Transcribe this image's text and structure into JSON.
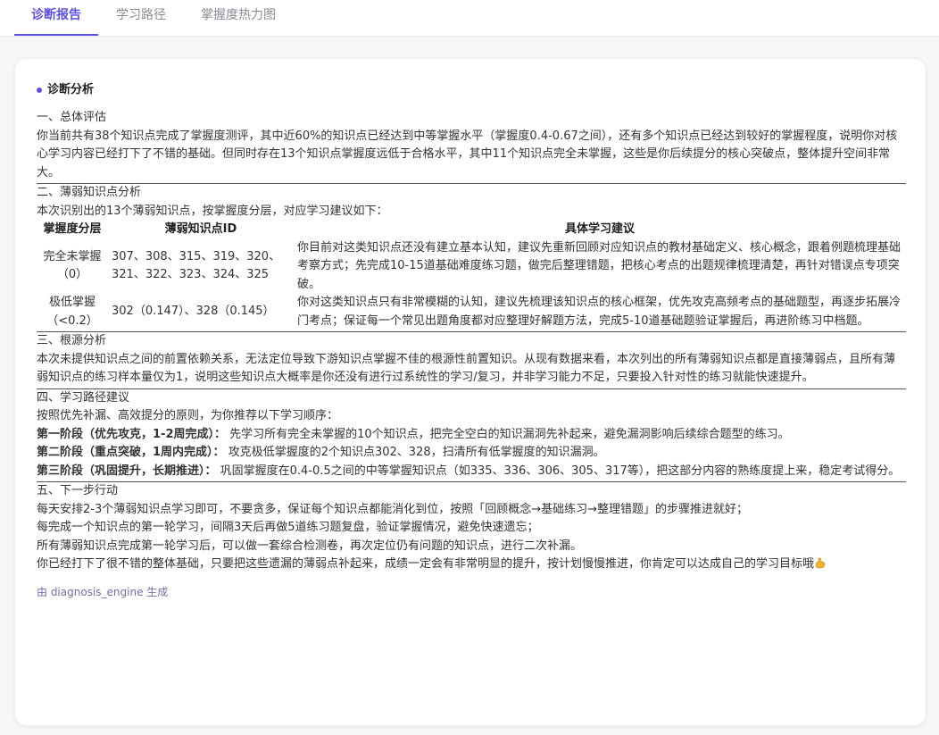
{
  "tabs": [
    {
      "label": "诊断报告",
      "active": true
    },
    {
      "label": "学习路径",
      "active": false
    },
    {
      "label": "掌握度热力图",
      "active": false
    }
  ],
  "colors": {
    "accent": "#5b4fe8",
    "footer_text": "#6f6fae"
  },
  "report": {
    "title": "诊断分析",
    "s1_heading": "一、总体评估",
    "s1_text": "你当前共有38个知识点完成了掌握度测评，其中近60%的知识点已经达到中等掌握水平（掌握度0.4-0.67之间），还有多个知识点已经达到较好的掌握程度，说明你对核心学习内容已经打下了不错的基础。但同时存在13个知识点掌握度远低于合格水平，其中11个知识点完全未掌握，这些是你后续提分的核心突破点，整体提升空间非常大。",
    "s2_heading": "二、薄弱知识点分析",
    "s2_intro": "本次识别出的13个薄弱知识点，按掌握度分层，对应学习建议如下：",
    "table": {
      "headers": [
        "掌握度分层",
        "薄弱知识点ID",
        "具体学习建议"
      ],
      "rows": [
        {
          "level": "完全未掌握（0）",
          "ids": "307、308、315、319、320、321、322、323、324、325",
          "advice": "你目前对这类知识点还没有建立基本认知，建议先重新回顾对应知识点的教材基础定义、核心概念，跟着例题梳理基础考察方式；先完成10-15道基础难度练习题，做完后整理错题，把核心考点的出题规律梳理清楚，再针对错误点专项突破。"
        },
        {
          "level": "极低掌握（<0.2）",
          "ids": "302（0.147）、328（0.145）",
          "advice": "你对这类知识点只有非常模糊的认知，建议先梳理该知识点的核心框架，优先攻克高频考点的基础题型，再逐步拓展冷门考点；保证每一个常见出题角度都对应整理好解题方法，完成5-10道基础题验证掌握后，再进阶练习中档题。"
        }
      ]
    },
    "s3_heading": "三、根源分析",
    "s3_text": "本次未提供知识点之间的前置依赖关系，无法定位导致下游知识点掌握不佳的根源性前置知识。从现有数据来看，本次列出的所有薄弱知识点都是直接薄弱点，且所有薄弱知识点的练习样本量仅为1，说明这些知识点大概率是你还没有进行过系统性的学习/复习，并非学习能力不足，只要投入针对性的练习就能快速提升。",
    "s4_heading": "四、学习路径建议",
    "s4_intro": "按照优先补漏、高效提分的原则，为你推荐以下学习顺序：",
    "phases": [
      {
        "label": "第一阶段（优先攻克，1-2周完成）：",
        "text": "先学习所有完全未掌握的10个知识点，把完全空白的知识漏洞先补起来，避免漏洞影响后续综合题型的练习。"
      },
      {
        "label": "第二阶段（重点突破，1周内完成）：",
        "text": "攻克极低掌握度的2个知识点302、328，扫清所有低掌握度的知识漏洞。"
      },
      {
        "label": "第三阶段（巩固提升，长期推进）：",
        "text": "巩固掌握度在0.4-0.5之间的中等掌握知识点（如335、336、306、305、317等），把这部分内容的熟练度提上来，稳定考试得分。"
      }
    ],
    "s5_heading": "五、下一步行动",
    "actions": [
      "每天安排2-3个薄弱知识点学习即可，不要贪多，保证每个知识点都能消化到位，按照「回顾概念→基础练习→整理错题」的步骤推进就好；",
      "每完成一个知识点的第一轮学习，间隔3天后再做5道练习题复盘，验证掌握情况，避免快速遗忘；",
      "所有薄弱知识点完成第一轮学习后，可以做一套综合检测卷，再次定位仍有问题的知识点，进行二次补漏。",
      "你已经打下了很不错的整体基础，只要把这些遗漏的薄弱点补起来，成绩一定会有非常明显的提升，按计划慢慢推进，你肯定可以达成自己的学习目标哦"
    ],
    "emoji_icon": "flexed-biceps-icon",
    "footer": "由 diagnosis_engine 生成"
  }
}
